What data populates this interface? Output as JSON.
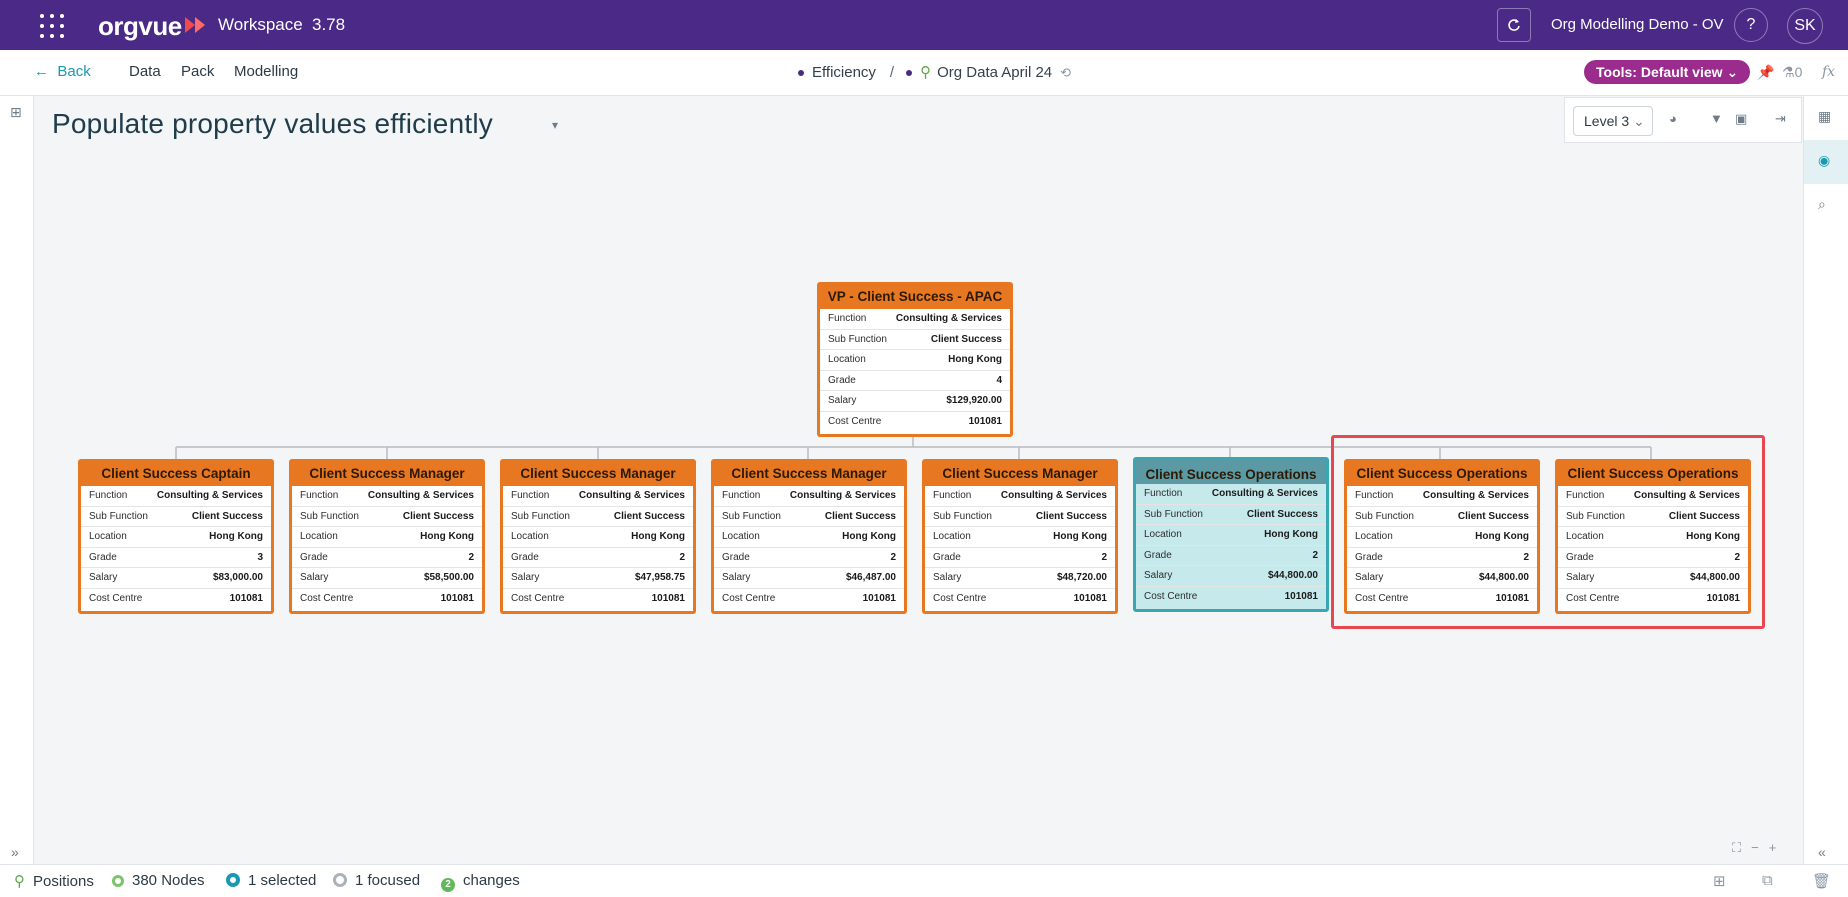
{
  "header": {
    "logo": "orgvue",
    "product": "Workspace",
    "version": "3.78",
    "project": "Org Modelling Demo - OV",
    "help": "?",
    "user_initials": "SK",
    "brand_color": "#4a2a86"
  },
  "nav": {
    "back": "Back",
    "items": [
      "Data",
      "Pack",
      "Modelling"
    ],
    "breadcrumb": {
      "first": "Efficiency",
      "separator": "/",
      "second": "Org Data April 24"
    },
    "tools": "Tools: Default view",
    "pin_count": "0",
    "fx": "fx"
  },
  "page": {
    "title": "Populate property values efficiently"
  },
  "toolbox": {
    "level": "Level 3"
  },
  "org_chart": {
    "root": {
      "title": "VP - Client Success - APAC",
      "fields": [
        {
          "k": "Function",
          "v": "Consulting & Services"
        },
        {
          "k": "Sub Function",
          "v": "Client Success"
        },
        {
          "k": "Location",
          "v": "Hong Kong"
        },
        {
          "k": "Grade",
          "v": "4"
        },
        {
          "k": "Salary",
          "v": "$129,920.00"
        },
        {
          "k": "Cost Centre",
          "v": "101081"
        }
      ]
    },
    "children": [
      {
        "title": "Client Success Captain",
        "fields": [
          {
            "k": "Function",
            "v": "Consulting & Services"
          },
          {
            "k": "Sub Function",
            "v": "Client Success"
          },
          {
            "k": "Location",
            "v": "Hong Kong"
          },
          {
            "k": "Grade",
            "v": "3"
          },
          {
            "k": "Salary",
            "v": "$83,000.00"
          },
          {
            "k": "Cost Centre",
            "v": "101081"
          }
        ]
      },
      {
        "title": "Client Success Manager",
        "fields": [
          {
            "k": "Function",
            "v": "Consulting & Services"
          },
          {
            "k": "Sub Function",
            "v": "Client Success"
          },
          {
            "k": "Location",
            "v": "Hong Kong"
          },
          {
            "k": "Grade",
            "v": "2"
          },
          {
            "k": "Salary",
            "v": "$58,500.00"
          },
          {
            "k": "Cost Centre",
            "v": "101081"
          }
        ]
      },
      {
        "title": "Client Success Manager",
        "fields": [
          {
            "k": "Function",
            "v": "Consulting & Services"
          },
          {
            "k": "Sub Function",
            "v": "Client Success"
          },
          {
            "k": "Location",
            "v": "Hong Kong"
          },
          {
            "k": "Grade",
            "v": "2"
          },
          {
            "k": "Salary",
            "v": "$47,958.75"
          },
          {
            "k": "Cost Centre",
            "v": "101081"
          }
        ]
      },
      {
        "title": "Client Success Manager",
        "fields": [
          {
            "k": "Function",
            "v": "Consulting & Services"
          },
          {
            "k": "Sub Function",
            "v": "Client Success"
          },
          {
            "k": "Location",
            "v": "Hong Kong"
          },
          {
            "k": "Grade",
            "v": "2"
          },
          {
            "k": "Salary",
            "v": "$46,487.00"
          },
          {
            "k": "Cost Centre",
            "v": "101081"
          }
        ]
      },
      {
        "title": "Client Success Manager",
        "fields": [
          {
            "k": "Function",
            "v": "Consulting & Services"
          },
          {
            "k": "Sub Function",
            "v": "Client Success"
          },
          {
            "k": "Location",
            "v": "Hong Kong"
          },
          {
            "k": "Grade",
            "v": "2"
          },
          {
            "k": "Salary",
            "v": "$48,720.00"
          },
          {
            "k": "Cost Centre",
            "v": "101081"
          }
        ]
      },
      {
        "title": "Client Success Operations",
        "selected": true,
        "fields": [
          {
            "k": "Function",
            "v": "Consulting & Services"
          },
          {
            "k": "Sub Function",
            "v": "Client Success"
          },
          {
            "k": "Location",
            "v": "Hong Kong"
          },
          {
            "k": "Grade",
            "v": "2"
          },
          {
            "k": "Salary",
            "v": "$44,800.00"
          },
          {
            "k": "Cost Centre",
            "v": "101081"
          }
        ]
      },
      {
        "title": "Client Success Operations",
        "fields": [
          {
            "k": "Function",
            "v": "Consulting & Services"
          },
          {
            "k": "Sub Function",
            "v": "Client Success"
          },
          {
            "k": "Location",
            "v": "Hong Kong"
          },
          {
            "k": "Grade",
            "v": "2"
          },
          {
            "k": "Salary",
            "v": "$44,800.00"
          },
          {
            "k": "Cost Centre",
            "v": "101081"
          }
        ]
      },
      {
        "title": "Client Success Operations",
        "fields": [
          {
            "k": "Function",
            "v": "Consulting & Services"
          },
          {
            "k": "Sub Function",
            "v": "Client Success"
          },
          {
            "k": "Location",
            "v": "Hong Kong"
          },
          {
            "k": "Grade",
            "v": "2"
          },
          {
            "k": "Salary",
            "v": "$44,800.00"
          },
          {
            "k": "Cost Centre",
            "v": "101081"
          }
        ]
      }
    ],
    "node_color": "#e87722",
    "selected_color": "#c6e9ec",
    "highlight_color": "#e8474f"
  },
  "status": {
    "positions": "Positions",
    "nodes": "380 Nodes",
    "selected": "1 selected",
    "focused": "1 focused",
    "changes_count": "2",
    "changes": "changes"
  }
}
